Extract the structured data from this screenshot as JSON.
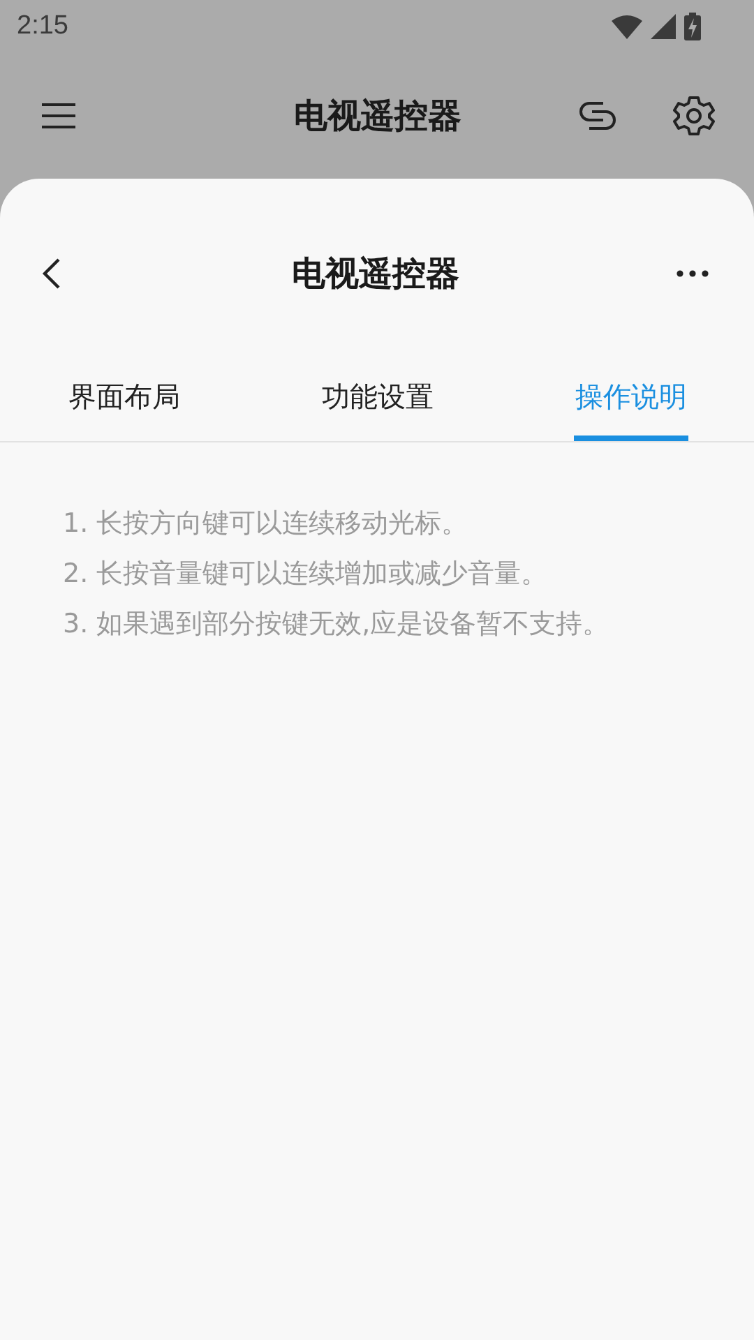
{
  "status_bar": {
    "time": "2:15"
  },
  "app_bar": {
    "title": "电视遥控器"
  },
  "sheet": {
    "title": "电视遥控器"
  },
  "tabs": [
    {
      "label": "界面布局",
      "selected": false
    },
    {
      "label": "功能设置",
      "selected": false
    },
    {
      "label": "操作说明",
      "selected": true
    }
  ],
  "instructions": [
    "1. 长按方向键可以连续移动光标。",
    "2. 长按音量键可以连续增加或减少音量。",
    "3. 如果遇到部分按键无效,应是设备暂不支持。"
  ]
}
